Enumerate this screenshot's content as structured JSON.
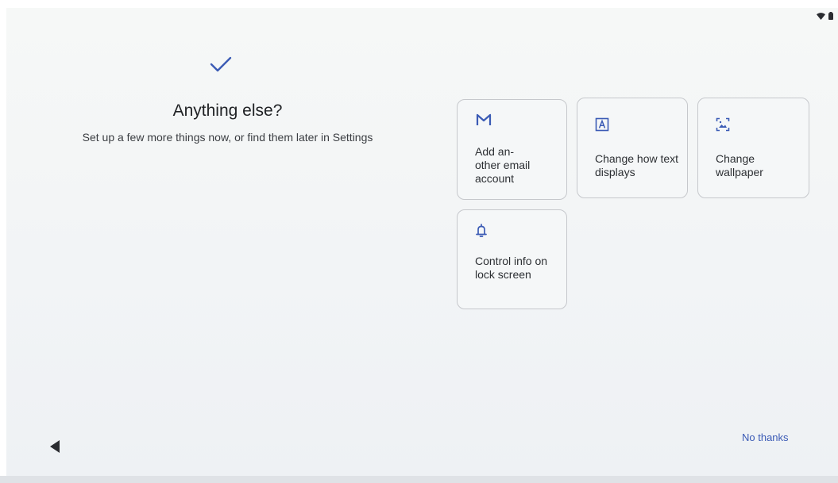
{
  "header": {
    "title": "Anything else?",
    "subtitle": "Set up a few more things now, or find them later in Settings"
  },
  "icons": {
    "check": "checkmark-icon",
    "wifi": "wifi-icon",
    "battery": "battery-icon",
    "back": "back-triangle-icon"
  },
  "options": [
    {
      "label": "Add an-\nother email account",
      "icon": "gmail-icon"
    },
    {
      "label": "Change how text displays",
      "icon": "text-display-icon"
    },
    {
      "label": "Change wallpaper",
      "icon": "wallpaper-icon"
    },
    {
      "label": "Control info on lock screen",
      "icon": "bell-icon"
    }
  ],
  "footer": {
    "no_thanks_label": "No thanks"
  },
  "colors": {
    "accent": "#3b5bb5",
    "background": "#f3f5f6",
    "card_border": "#c6c8cc"
  }
}
